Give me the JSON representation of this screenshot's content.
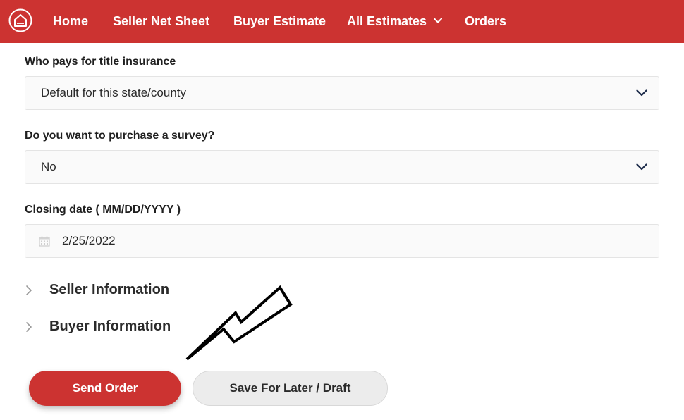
{
  "nav": {
    "items": [
      {
        "label": "Home"
      },
      {
        "label": "Seller Net Sheet"
      },
      {
        "label": "Buyer Estimate"
      },
      {
        "label": "All Estimates"
      },
      {
        "label": "Orders"
      }
    ]
  },
  "form": {
    "title_insurance": {
      "label": "Who pays for title insurance",
      "value": "Default for this state/county"
    },
    "survey": {
      "label": "Do you want to purchase a survey?",
      "value": "No"
    },
    "closing_date": {
      "label": "Closing date ( MM/DD/YYYY )",
      "value": "2/25/2022"
    }
  },
  "sections": [
    {
      "label": "Seller Information"
    },
    {
      "label": "Buyer Information"
    }
  ],
  "actions": {
    "send_label": "Send Order",
    "save_label": "Save For Later / Draft"
  },
  "colors": {
    "brand": "#cc3331",
    "secondary_button": "#ececec"
  }
}
